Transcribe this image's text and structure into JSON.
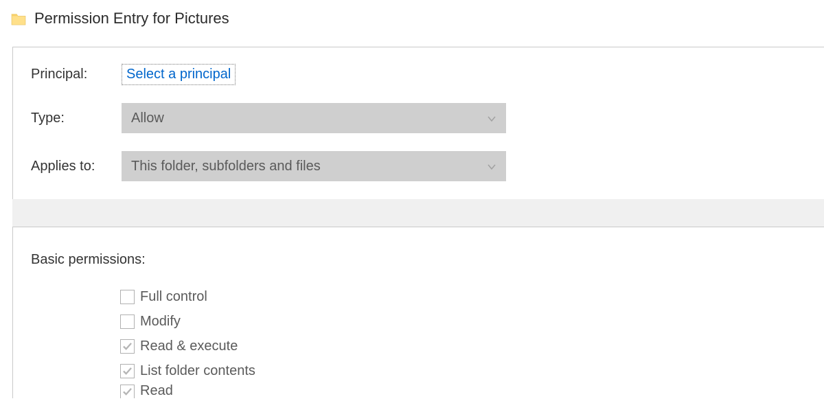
{
  "title": "Permission Entry for Pictures",
  "form": {
    "principal_label": "Principal:",
    "principal_link": "Select a principal",
    "type_label": "Type:",
    "type_value": "Allow",
    "applies_label": "Applies to:",
    "applies_value": "This folder, subfolders and files"
  },
  "permissions": {
    "section_label": "Basic permissions:",
    "items": [
      {
        "label": "Full control",
        "checked": false
      },
      {
        "label": "Modify",
        "checked": false
      },
      {
        "label": "Read & execute",
        "checked": true
      },
      {
        "label": "List folder contents",
        "checked": true
      },
      {
        "label": "Read",
        "checked": true
      }
    ]
  }
}
